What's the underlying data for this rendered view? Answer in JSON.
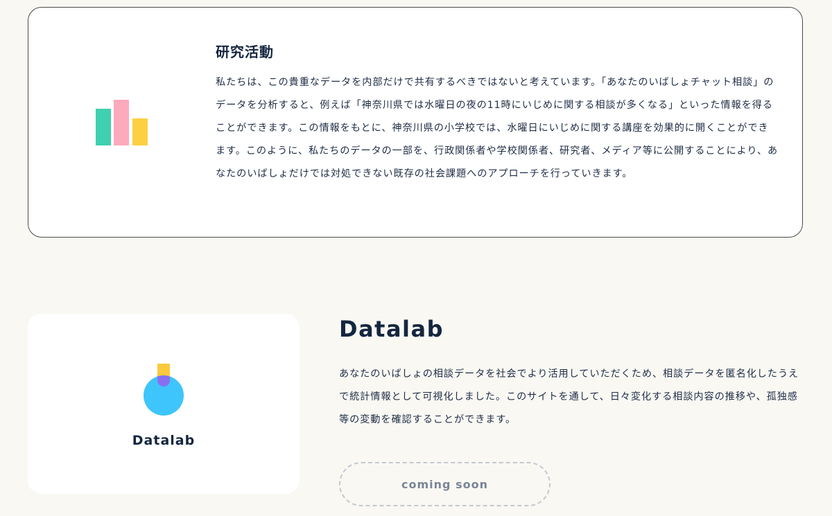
{
  "research": {
    "title": "研究活動",
    "icon": "bar-chart-icon",
    "body": "私たちは、この貴重なデータを内部だけで共有するべきではないと考えています。「あなたのいばしょチャット相談」のデータを分析すると、例えば「神奈川県では水曜日の夜の11時にいじめに関する相談が多くなる」といった情報を得ることができます。この情報をもとに、神奈川県の小学校では、水曜日にいじめに関する講座を効果的に開くことができます。このように、私たちのデータの一部を、行政関係者や学校関係者、研究者、メディア等に公開することにより、あなたのいばしょだけでは対処できない既存の社会課題へのアプローチを行っていきます。",
    "icon_colors": [
      "#3fd0b0",
      "#fdaabd",
      "#fdd043"
    ]
  },
  "datalab": {
    "card_label": "Datalab",
    "icon": "flask-icon",
    "title": "Datalab",
    "body": "あなたのいばしょの相談データを社会でより活用していただくため、相談データを匿名化したうえで統計情報として可視化しました。このサイトを通して、日々変化する相談内容の推移や、孤独感等の変動を確認することができます。",
    "button_label": "coming soon",
    "icon_colors": [
      "#fbc93c",
      "#3ec5fb",
      "#8a6ef0"
    ]
  }
}
